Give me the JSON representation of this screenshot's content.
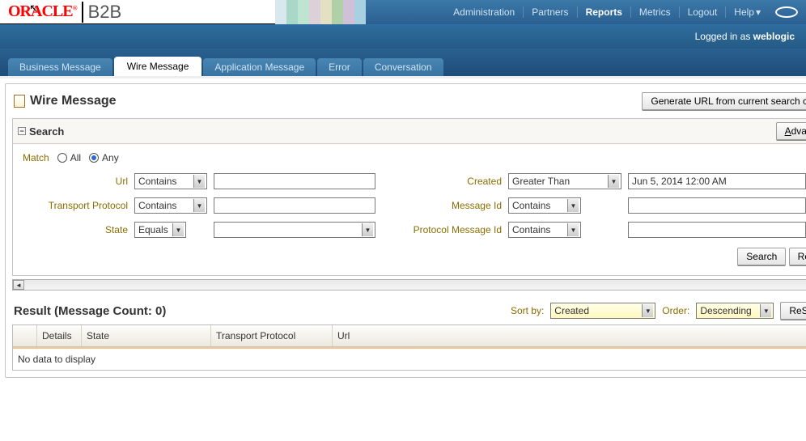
{
  "app": {
    "brand": "ORACLE",
    "sub": "B2B",
    "reg": "®"
  },
  "nav": {
    "administration": "Administration",
    "partners": "Partners",
    "reports": "Reports",
    "metrics": "Metrics",
    "logout": "Logout",
    "help": "Help"
  },
  "logged_in_prefix": "Logged in as ",
  "logged_in_user": "weblogic",
  "tabs": {
    "business_message": "Business Message",
    "wire_message": "Wire Message",
    "application_message": "Application Message",
    "error": "Error",
    "conversation": "Conversation"
  },
  "page": {
    "title": "Wire Message",
    "generate_url_btn": "Generate URL from current search criteria"
  },
  "search": {
    "heading": "Search",
    "advanced_btn": "Advanced",
    "match_label": "Match",
    "all_label": "All",
    "any_label": "Any",
    "labels": {
      "url": "Url",
      "transport_protocol": "Transport Protocol",
      "state": "State",
      "created": "Created",
      "message_id": "Message Id",
      "protocol_message_id": "Protocol Message Id"
    },
    "ops": {
      "contains": "Contains",
      "equals": "Equals",
      "greater_than": "Greater Than"
    },
    "created_value": "Jun 5, 2014 12:00 AM",
    "search_btn": "Search",
    "reset_btn": "Reset"
  },
  "result": {
    "heading_prefix": "Result (Message Count: ",
    "count": "0",
    "heading_suffix": ")",
    "sort_by_label": "Sort by:",
    "sort_by_value": "Created",
    "order_label": "Order:",
    "order_value": "Descending",
    "resubmit_btn": "ReSubmit",
    "columns": {
      "details": "Details",
      "state": "State",
      "transport_protocol": "Transport Protocol",
      "url": "Url"
    },
    "no_data": "No data to display"
  },
  "stripe_colors": [
    "#d9e8ef",
    "#a8d8c8",
    "#c0e4d2",
    "#ded0d8",
    "#e4e0c4",
    "#b0d0a8",
    "#d0c0d8",
    "#a8d0e0"
  ],
  "chevron_down": "▾",
  "tri_down": "▼",
  "tri_left": "◄",
  "tri_right": "►",
  "tri_up": "▲",
  "minus": "−"
}
